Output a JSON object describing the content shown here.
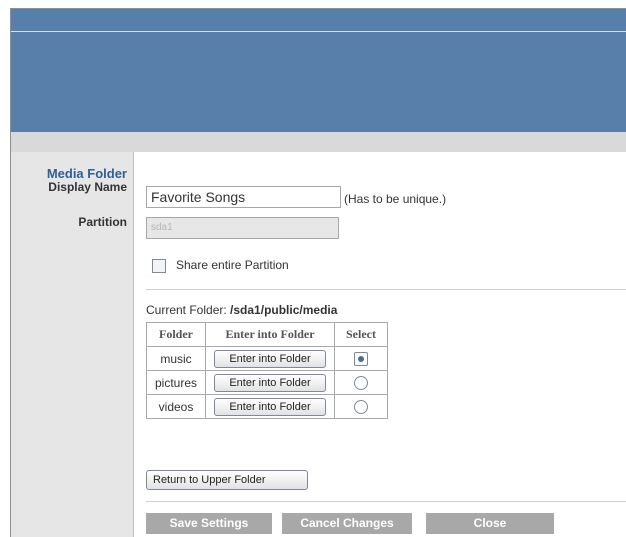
{
  "labels": {
    "section": "Media Folder",
    "display_name": "Display Name",
    "partition": "Partition"
  },
  "form": {
    "display_name_value": "Favorite Songs",
    "display_name_hint": "(Has to be unique.)",
    "partition_value": "sda1",
    "share_label": "Share entire Partition",
    "share_checked": false
  },
  "current_folder": {
    "label": "Current Folder:",
    "path": "/sda1/public/media"
  },
  "folder_table": {
    "headers": [
      "Folder",
      "Enter into Folder",
      "Select"
    ],
    "rows": [
      {
        "name": "music",
        "button": "Enter into Folder",
        "selected": true
      },
      {
        "name": "pictures",
        "button": "Enter into Folder",
        "selected": false
      },
      {
        "name": "videos",
        "button": "Enter into Folder",
        "selected": false
      }
    ]
  },
  "buttons": {
    "return_upper": "Return to Upper Folder",
    "save": "Save Settings",
    "cancel": "Cancel Changes",
    "close": "Close"
  },
  "colors": {
    "header": "#587fa9",
    "section_label": "#2f5f93",
    "action_button": "#a8a8a8"
  }
}
